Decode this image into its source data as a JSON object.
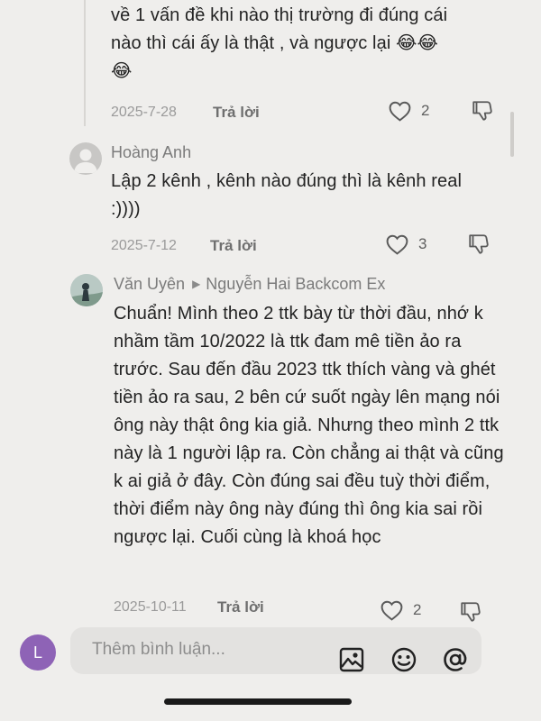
{
  "comments": [
    {
      "body_line1": "về 1 vấn đề khi nào thị trường đi đúng cái",
      "body_line2": "nào thì cái ấy là thật , và ngược lại",
      "date": "2025-7-28",
      "reply": "Trả lời",
      "likes": "2"
    },
    {
      "author": "Hoàng Anh",
      "body": "Lập 2 kênh , kênh nào đúng thì là kênh real :))))",
      "date": "2025-7-12",
      "reply": "Trả lời",
      "likes": "3"
    },
    {
      "author": "Văn Uyên",
      "reply_to": "Nguyễn Hai Backcom Ex",
      "body": "Chuẩn! Mình theo 2 ttk bày từ thời đầu, nhớ k nhầm tầm 10/2022 là ttk đam mê tiền ảo ra trước. Sau đến đầu 2023 ttk thích vàng và ghét tiền ảo ra sau, 2 bên cứ suốt ngày lên mạng nói ông này thật ông kia giả. Nhưng theo mình 2 ttk này là 1 người lập ra. Còn chẳng ai thật và cũng k ai giả ở đây. Còn đúng sai đều tuỳ thời điểm, thời điểm này ông này đúng thì ông kia sai rồi ngược lại. Cuối cùng là khoá học",
      "date": "2025-10-11",
      "reply": "Trả lời",
      "likes": "2"
    }
  ],
  "composer": {
    "avatar_initial": "L",
    "placeholder": "Thêm bình luận..."
  },
  "icons": {
    "laugh": "😂",
    "like": "heart-outline-icon",
    "dislike": "thumbs-down-icon",
    "image": "image-icon",
    "emoji": "emoji-icon",
    "mention": "at-icon"
  },
  "colors": {
    "background": "#efeeec",
    "avatar_me": "#8e63b6"
  }
}
